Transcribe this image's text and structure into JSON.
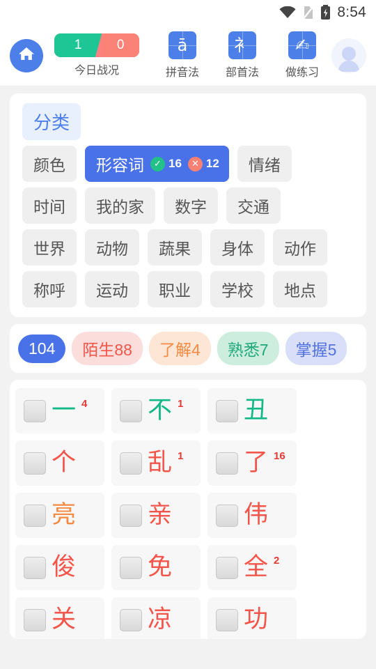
{
  "statusbar": {
    "time": "8:54",
    "wifi_icon": "wifi-icon",
    "sim_icon": "no-sim-icon",
    "battery_icon": "battery-charging-icon"
  },
  "header": {
    "home_icon": "home-icon",
    "score": {
      "correct": "1",
      "wrong": "0",
      "label": "今日战况"
    },
    "tools": [
      {
        "glyph": "ā",
        "label": "拼音法",
        "name": "pinyin-method"
      },
      {
        "glyph": "衤",
        "label": "部首法",
        "name": "radical-method"
      },
      {
        "glyph": "✍",
        "label": "做练习",
        "name": "practice"
      }
    ],
    "avatar_icon": "avatar-placeholder-icon"
  },
  "categories": {
    "title": "分类",
    "rows": [
      [
        {
          "label": "颜色",
          "active": false
        },
        {
          "label": "形容词",
          "active": true,
          "correct": "16",
          "wrong": "12"
        },
        {
          "label": "情绪",
          "active": false
        }
      ],
      [
        {
          "label": "时间",
          "active": false
        },
        {
          "label": "我的家",
          "active": false
        },
        {
          "label": "数字",
          "active": false
        },
        {
          "label": "交通",
          "active": false
        }
      ],
      [
        {
          "label": "世界",
          "active": false
        },
        {
          "label": "动物",
          "active": false
        },
        {
          "label": "蔬果",
          "active": false
        },
        {
          "label": "身体",
          "active": false
        },
        {
          "label": "动作",
          "active": false
        }
      ],
      [
        {
          "label": "称呼",
          "active": false
        },
        {
          "label": "运动",
          "active": false
        },
        {
          "label": "职业",
          "active": false
        },
        {
          "label": "学校",
          "active": false
        },
        {
          "label": "地点",
          "active": false
        }
      ]
    ]
  },
  "stats": {
    "pills": [
      {
        "label": "104",
        "bg": "#4a72e8",
        "fg": "#ffffff",
        "name": "stat-total"
      },
      {
        "label": "陌生88",
        "bg": "#fbdedb",
        "fg": "#f4554a",
        "name": "stat-unfamiliar"
      },
      {
        "label": "了解4",
        "bg": "#fde6d6",
        "fg": "#f58a43",
        "name": "stat-known"
      },
      {
        "label": "熟悉7",
        "bg": "#cdeddf",
        "fg": "#1fa97b",
        "name": "stat-familiar"
      },
      {
        "label": "掌握5",
        "bg": "#d9dff8",
        "fg": "#5271e0",
        "name": "stat-mastered"
      }
    ]
  },
  "grid": {
    "checkbox_icon": "checkbox-unchecked-icon",
    "items": [
      {
        "char": "一",
        "num": "4",
        "color": "#12b886"
      },
      {
        "char": "不",
        "num": "1",
        "color": "#12b886"
      },
      {
        "char": "丑",
        "num": "",
        "color": "#12b886"
      },
      {
        "char": "个",
        "num": "",
        "color": "#f4554a"
      },
      {
        "char": "乱",
        "num": "1",
        "color": "#f4554a"
      },
      {
        "char": "了",
        "num": "16",
        "color": "#f4554a"
      },
      {
        "char": "亮",
        "num": "",
        "color": "#f58a43"
      },
      {
        "char": "亲",
        "num": "",
        "color": "#f4554a"
      },
      {
        "char": "伟",
        "num": "",
        "color": "#f4554a"
      },
      {
        "char": "俊",
        "num": "",
        "color": "#f4554a"
      },
      {
        "char": "免",
        "num": "",
        "color": "#f4554a"
      },
      {
        "char": "全",
        "num": "2",
        "color": "#f4554a"
      },
      {
        "char": "关",
        "num": "",
        "color": "#f4554a"
      },
      {
        "char": "凉",
        "num": "",
        "color": "#f4554a"
      },
      {
        "char": "功",
        "num": "",
        "color": "#f4554a"
      }
    ]
  }
}
